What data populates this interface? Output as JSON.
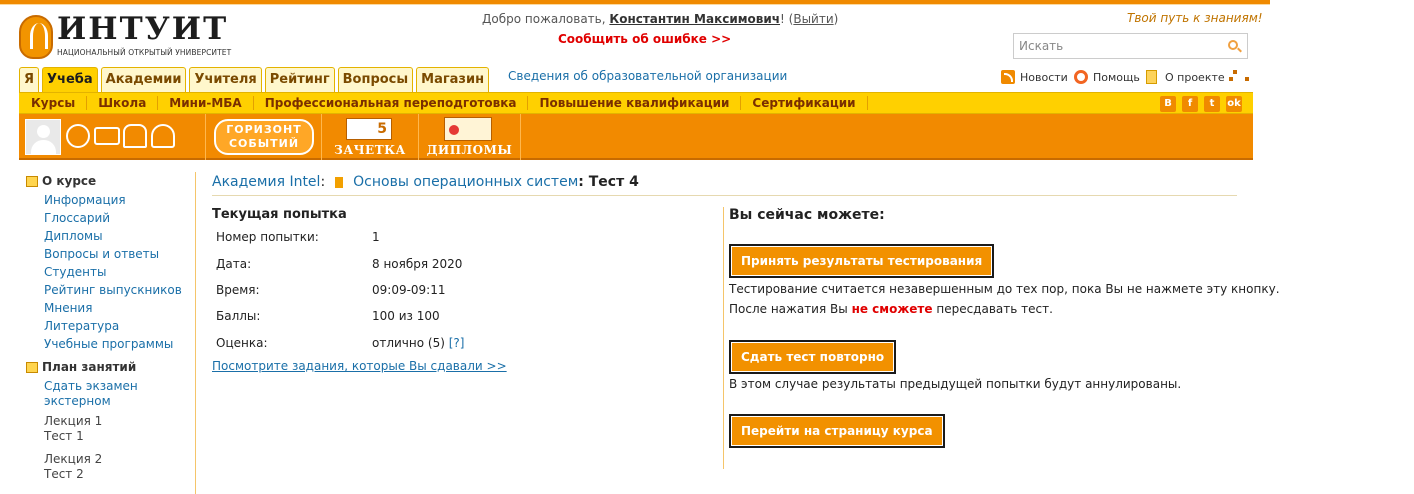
{
  "header": {
    "logo_title": "ИНТУИТ",
    "logo_subtitle": "НАЦИОНАЛЬНЫЙ ОТКРЫТЫЙ УНИВЕРСИТЕТ",
    "welcome_prefix": "Добро пожаловать,",
    "user_name": "Константин Максимович",
    "logout_open": "! (",
    "logout_label": "Выйти",
    "logout_close": ")",
    "report_error": "Сообщить об ошибке >>",
    "slogan": "Твой путь к знаниям!",
    "search_placeholder": "Искать"
  },
  "main_tabs": [
    {
      "label": "Я"
    },
    {
      "label": "Учеба"
    },
    {
      "label": "Академии"
    },
    {
      "label": "Учителя"
    },
    {
      "label": "Рейтинг"
    },
    {
      "label": "Вопросы"
    },
    {
      "label": "Магазин"
    }
  ],
  "edu_org_link": "Сведения об образовательной организации",
  "top_links": {
    "news": "Новости",
    "help": "Помощь",
    "about": "О проекте"
  },
  "subnav": [
    {
      "label": "Курсы"
    },
    {
      "label": "Школа"
    },
    {
      "label": "Мини-МБА"
    },
    {
      "label": "Профессиональная переподготовка"
    },
    {
      "label": "Повышение квалификации"
    },
    {
      "label": "Сертификации"
    }
  ],
  "social": [
    "B",
    "f",
    "t",
    "ok"
  ],
  "toolbar": {
    "horizon_line1": "ГОРИЗОНТ",
    "horizon_line2": "СОБЫТИЙ",
    "zachetka_mark": "5",
    "zachetka_label": "ЗАЧЕТКА",
    "diplomy_label": "ДИПЛОМЫ"
  },
  "sidebar": {
    "about_title": "О курсе",
    "about_items": [
      "Информация",
      "Глоссарий",
      "Дипломы",
      "Вопросы и ответы",
      "Студенты",
      "Рейтинг выпускников",
      "Мнения",
      "Литература",
      "Учебные программы"
    ],
    "plan_title": "План занятий",
    "plan_link": "Сдать экзамен экстерном",
    "lectures": [
      {
        "lecture": "Лекция 1",
        "test": "Тест 1"
      },
      {
        "lecture": "Лекция 2",
        "test": "Тест 2"
      }
    ]
  },
  "breadcrumb": {
    "academy": "Академия Intel",
    "sep": ":",
    "course": "Основы операционных систем",
    "current": ": Тест 4"
  },
  "attempt": {
    "title": "Текущая попытка",
    "rows": [
      {
        "key": "Номер попытки:",
        "value": "1"
      },
      {
        "key": "Дата:",
        "value": "8 ноября 2020"
      },
      {
        "key": "Время:",
        "value": "09:09-09:11"
      },
      {
        "key": "Баллы:",
        "value": "100 из 100"
      },
      {
        "key": "Оценка:",
        "value": "отлично (5)",
        "help": "[?]"
      }
    ],
    "view_tasks": "Посмотрите задания, которые Вы сдавали >>"
  },
  "actions": {
    "title": "Вы сейчас можете:",
    "accept_button": "Принять результаты тестирования",
    "accept_note1": "Тестирование считается незавершенным до тех пор, пока Вы не нажмете эту кнопку.",
    "accept_note2_pre": "После нажатия Вы",
    "accept_note2_red": "не сможете",
    "accept_note2_post": "пересдавать тест.",
    "retake_button": "Сдать тест повторно",
    "retake_note": "В этом случае результаты предыдущей попытки будут аннулированы.",
    "course_button": "Перейти на страницу курса"
  },
  "colors": {
    "accent_orange": "#f28a00",
    "nav_yellow": "#ffd000",
    "link_blue": "#1a6fa8",
    "error_red": "#e00000"
  }
}
